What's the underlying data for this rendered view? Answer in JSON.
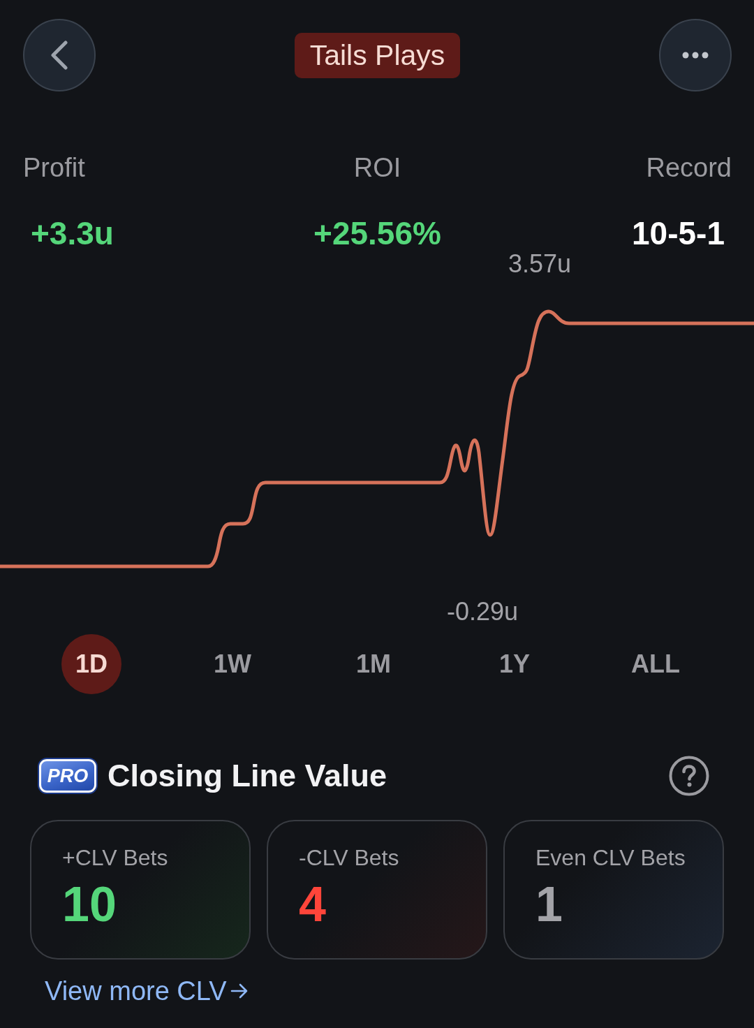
{
  "header": {
    "title": "Tails Plays"
  },
  "stats": [
    {
      "label": "Profit",
      "value": "+3.3u",
      "kind": "gain"
    },
    {
      "label": "ROI",
      "value": "+25.56%",
      "kind": "gain"
    },
    {
      "label": "Record",
      "value": "10-5-1",
      "kind": "plain"
    }
  ],
  "chart": {
    "high_label": "3.57u",
    "low_label": "-0.29u"
  },
  "periods": [
    {
      "label": "1D",
      "selected": true
    },
    {
      "label": "1W",
      "selected": false
    },
    {
      "label": "1M",
      "selected": false
    },
    {
      "label": "1Y",
      "selected": false
    },
    {
      "label": "ALL",
      "selected": false
    }
  ],
  "clv": {
    "badge": "PRO",
    "title": "Closing Line Value",
    "cards": [
      {
        "label": "+CLV Bets",
        "value": "10",
        "kind": "positive"
      },
      {
        "label": "-CLV Bets",
        "value": "4",
        "kind": "negative"
      },
      {
        "label": "Even CLV Bets",
        "value": "1",
        "kind": "even"
      }
    ],
    "link": "View more CLV"
  }
}
